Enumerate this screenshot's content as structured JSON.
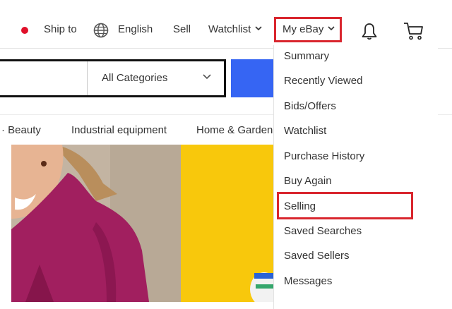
{
  "topbar": {
    "ship_to": "Ship to",
    "language": "English",
    "sell": "Sell",
    "watchlist": "Watchlist",
    "my_ebay": "My eBay"
  },
  "search": {
    "category_selected": "All Categories"
  },
  "nav": {
    "items": [
      "· Beauty",
      "Industrial equipment",
      "Home & Garden"
    ]
  },
  "dropdown": {
    "items": [
      "Summary",
      "Recently Viewed",
      "Bids/Offers",
      "Watchlist",
      "Purchase History",
      "Buy Again",
      "Selling",
      "Saved Searches",
      "Saved Sellers",
      "Messages"
    ]
  },
  "colors": {
    "highlight_box": "#d9262e",
    "search_button": "#3665f3",
    "flag_red": "#e0102a",
    "banner_yellow": "#f8c80c",
    "sweater_magenta": "#a11f5f"
  },
  "icons": [
    "flag-icon",
    "globe-icon",
    "chevron-down-icon",
    "bell-icon",
    "cart-icon"
  ]
}
